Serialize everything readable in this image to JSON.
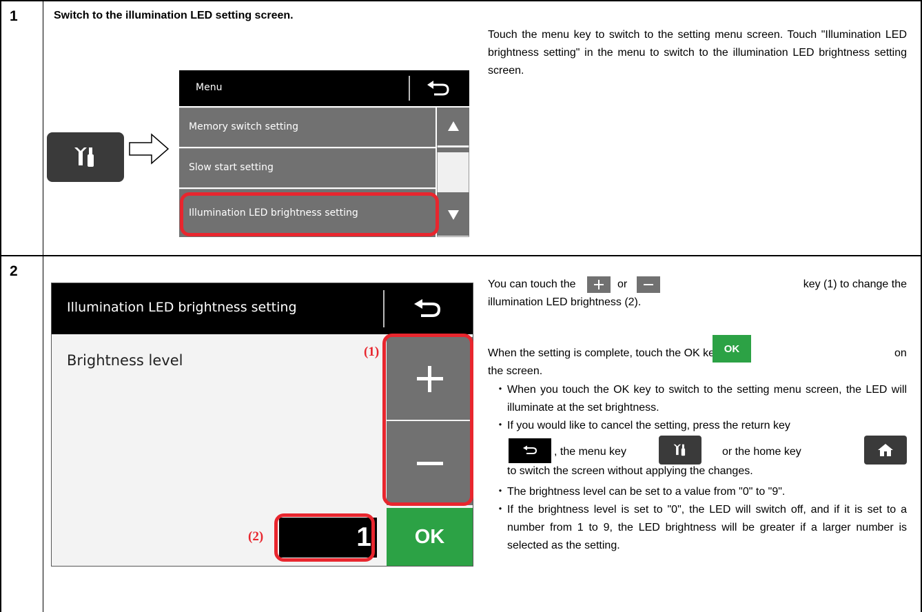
{
  "step1": {
    "number": "1",
    "title": "Switch to the illumination LED setting screen.",
    "description": "Touch the menu key to switch to the setting menu screen. Touch \"Illumination LED brightness setting\" in the menu to switch to the illumination LED brightness setting screen.",
    "menu": {
      "title": "Menu",
      "items": [
        "Memory switch setting",
        "Slow start setting",
        "Illumination LED brightness setting"
      ]
    }
  },
  "step2": {
    "number": "2",
    "screen": {
      "title": "Illumination LED brightness setting",
      "label": "Brightness level",
      "value": "1",
      "ok_label": "OK",
      "callout1": "(1)",
      "callout2": "(2)"
    },
    "p1_a": "You can touch the",
    "p1_or": "or",
    "p1_b": "key (1) to change the",
    "p1_c": "illumination LED brightness (2).",
    "p2_a": "When the setting is complete, touch the OK key",
    "p2_ok": "OK",
    "p2_on": "on",
    "p2_b": "the screen.",
    "bullet_mark": "・",
    "b1": "When you touch the OK key to switch to the setting menu screen, the LED will illuminate at the set brightness.",
    "b2_a": "If you would like to cancel the setting, press the return key",
    "b2_menu": ", the menu key",
    "b2_home": "or the home key",
    "b2_c": "to switch the screen without applying the changes.",
    "b3": "The brightness level can be set to a value from \"0\" to \"9\".",
    "b4": "If the brightness level is set to \"0\", the LED will switch off, and if it is set to a number from 1 to 9, the LED brightness will be greater if a larger number is selected as the setting."
  },
  "colors": {
    "highlight": "#e8262e",
    "ok_green": "#2ca245",
    "key_gray": "#717171"
  }
}
